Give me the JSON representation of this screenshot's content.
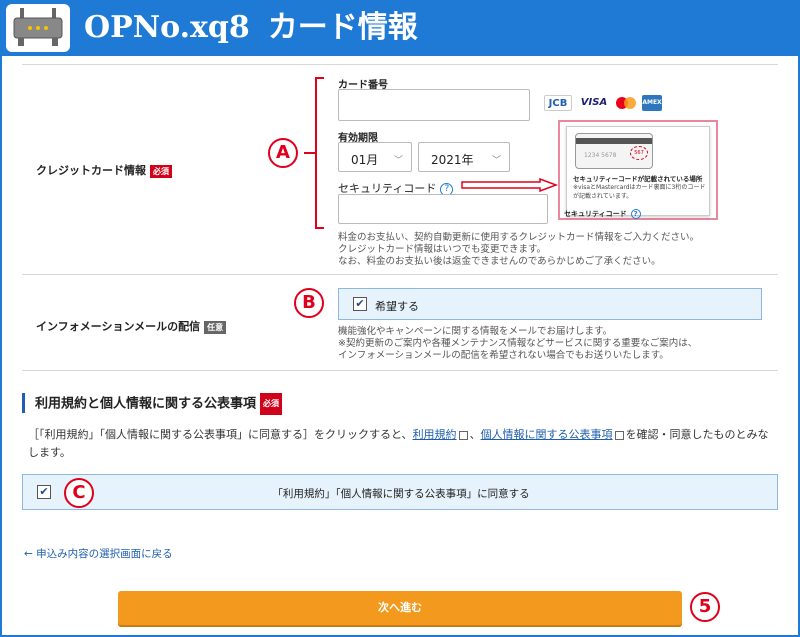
{
  "header": {
    "title_code": "OPNo.xq8",
    "title_text": "カード情報"
  },
  "credit": {
    "section_label": "クレジットカード情報",
    "required_badge": "必須",
    "card_number_label": "カード番号",
    "card_number_value": "",
    "expiry_label": "有効期限",
    "expiry_month": "01月",
    "expiry_year": "2021年",
    "security_label": "セキュリティコード",
    "security_value": "",
    "help_glyph": "?",
    "brands": [
      "JCB",
      "VISA",
      "MC",
      "AMEX"
    ],
    "notes": [
      "料金のお支払い、契約自動更新に使用するクレジットカード情報をご入力ください。",
      "クレジットカード情報はいつでも変更できます。",
      "なお、料金のお支払い後は返金できませんのであらかじめご了承ください。"
    ]
  },
  "tooltip": {
    "card_number_sample": "1234 5678",
    "code_sample": "567",
    "title": "セキュリティーコードが記載されている場所",
    "text": "※visaとMastercardはカード裏面に3桁のコードが記載されています。",
    "footer": "セキュリティコード"
  },
  "info_mail": {
    "section_label": "インフォメーションメールの配信",
    "optional_badge": "任意",
    "option_label": "希望する",
    "checked_glyph": "✔",
    "notes": [
      "機能強化やキャンペーンに関する情報をメールでお届けします。",
      "※契約更新のご案内や各種メンテナンス情報などサービスに関する重要なご案内は、",
      "インフォメーションメールの配信を希望されない場合でもお送りいたします。"
    ]
  },
  "terms": {
    "title": "利用規約と個人情報に関する公表事項",
    "required_badge": "必須",
    "text_part1": "［「利用規約」「個人情報に関する公表事項」に同意する］をクリックすると、",
    "link_terms": "利用規約",
    "separator": "、",
    "link_privacy": "個人情報に関する公表事項",
    "text_part2": "を確認・同意したものとみなします。",
    "agree_label": "「利用規約」「個人情報に関する公表事項」に同意する",
    "checked_glyph": "✔"
  },
  "nav": {
    "back_link": "← 申込み内容の選択画面に戻る",
    "next_button": "次へ進む"
  },
  "annotations": {
    "a": "A",
    "b": "B",
    "c": "C",
    "five": "5"
  },
  "colors": {
    "header_blue": "#1f7ad6",
    "annotation_red": "#e0001b",
    "next_orange": "#f39a1e",
    "highlight_bg": "#e6f2fc"
  }
}
